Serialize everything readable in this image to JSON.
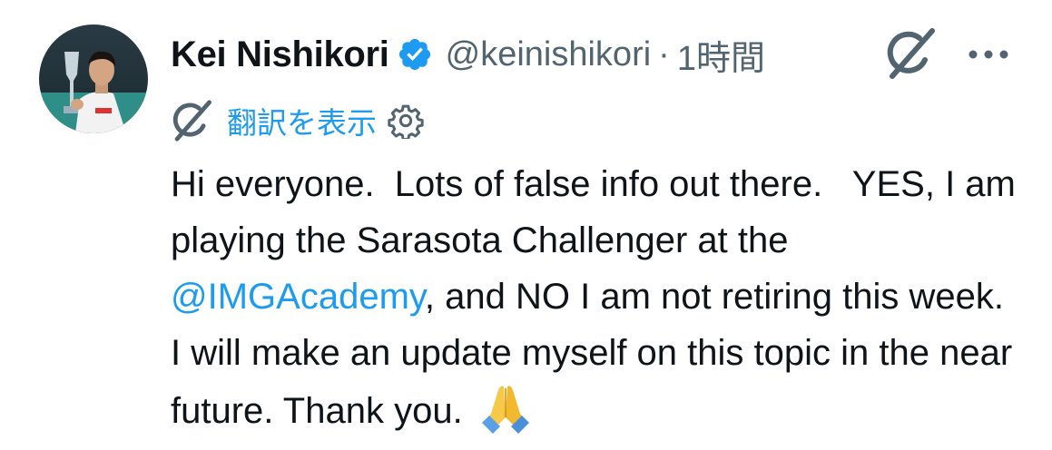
{
  "author": {
    "display_name": "Kei Nishikori",
    "handle": "@keinishikori",
    "separator": "·",
    "time": "1時間",
    "verified": true
  },
  "translate": {
    "label": "翻訳を表示"
  },
  "tweet": {
    "text_part1": "Hi everyone.  Lots of false info out there.   YES, I am playing the Sarasota Challenger at the ",
    "mention": "@IMGAcademy",
    "text_part2": ", and NO I am not retiring this week.  I will make an update myself on this topic in the near future. Thank you. ",
    "emoji": "folded-hands"
  },
  "icons": {
    "verified": "verified-badge-icon",
    "grok": "grok-icon",
    "more": "more-options-icon",
    "settings": "gear-icon"
  },
  "colors": {
    "accent": "#1d9bf0",
    "text": "#0f1419",
    "secondary": "#536471"
  }
}
